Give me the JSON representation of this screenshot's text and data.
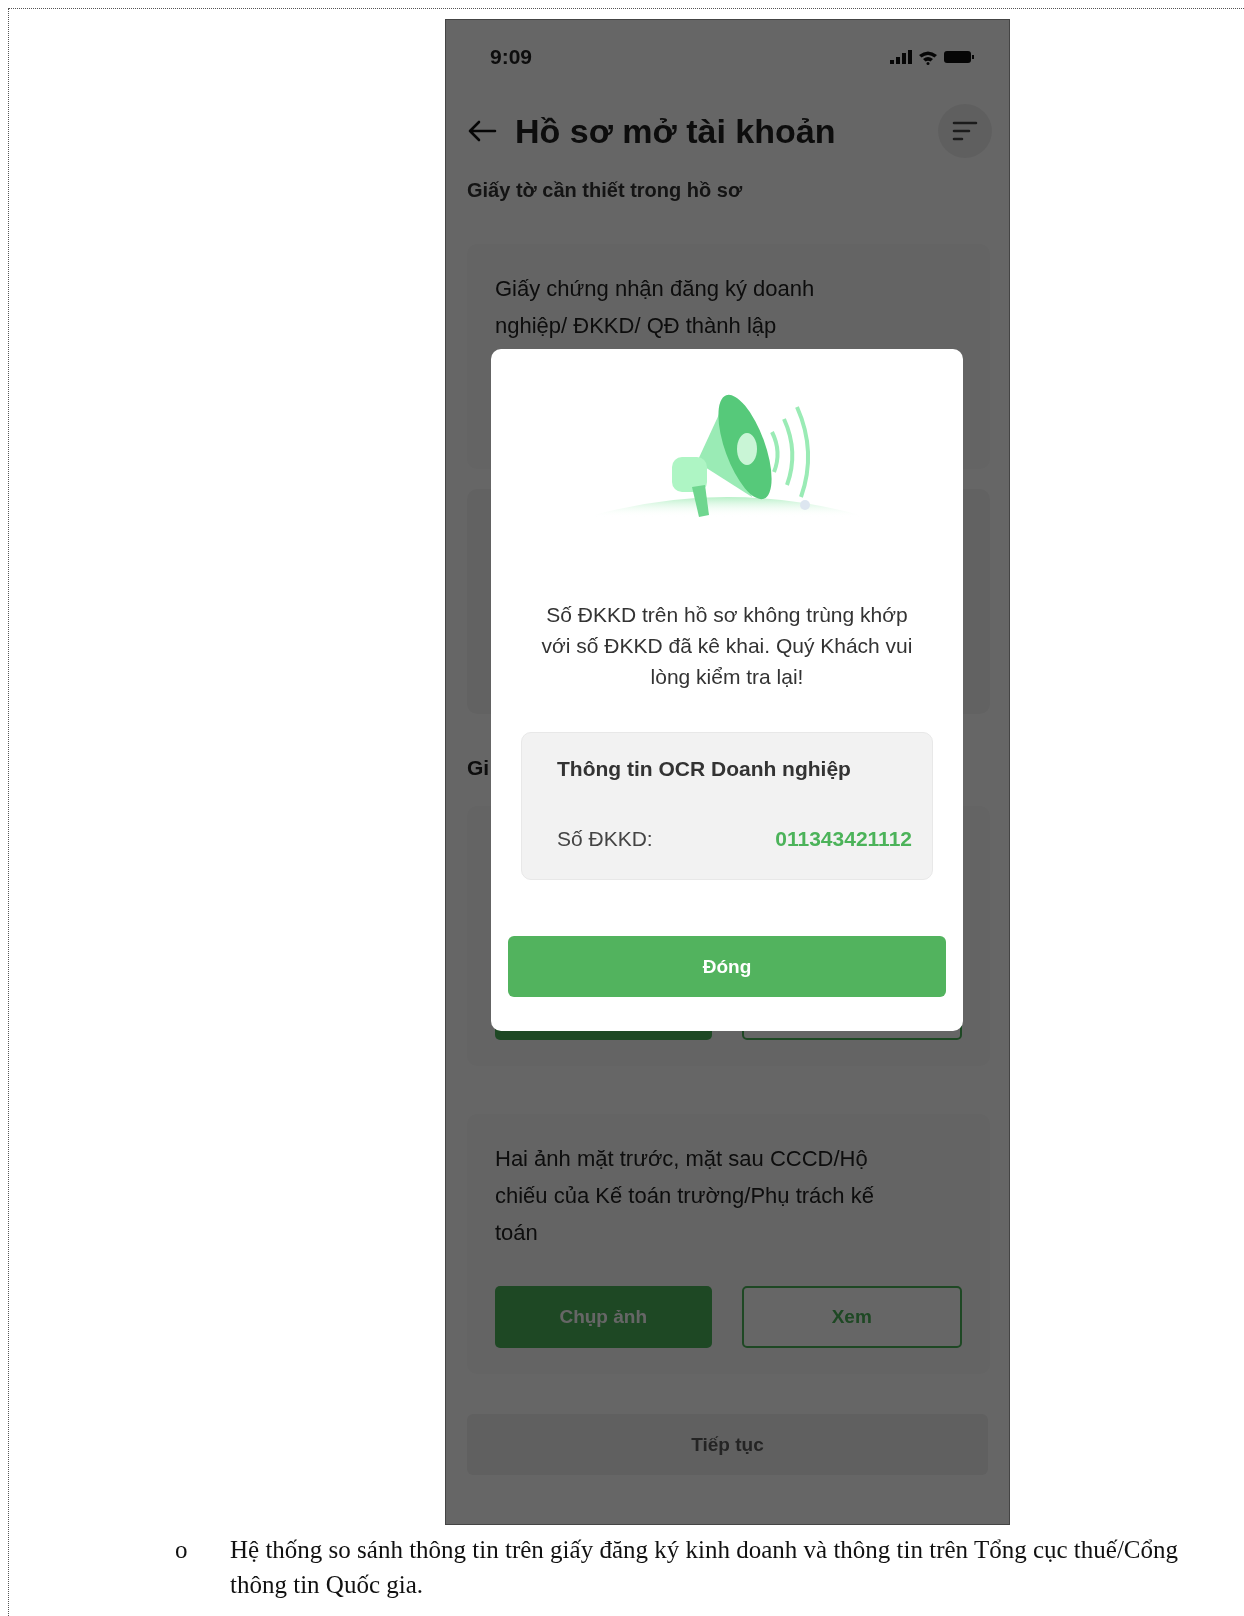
{
  "screenshot": {
    "status_bar": {
      "time": "9:09"
    },
    "header": {
      "title": "Hồ sơ mở tài khoản"
    },
    "section_title": "Giấy tờ cần thiết trong hồ sơ",
    "cards": [
      {
        "kind": "document",
        "text": "Giấy chứng nhận đăng ký doanh nghiệp/ ĐKKD/ QĐ thành lập"
      },
      {
        "kind": "covered"
      },
      {
        "kind": "document",
        "heading": "Gi",
        "buttons": [
          {
            "kind": "primary"
          },
          {
            "kind": "secondary"
          }
        ]
      },
      {
        "kind": "document",
        "text": "Hai ảnh mặt trước, mặt sau CCCD/Hộ chiếu của Kế toán trường/Phụ trách kế toán",
        "buttons": [
          {
            "kind": "primary",
            "label": "Chụp ảnh"
          },
          {
            "kind": "secondary",
            "label": "Xem"
          }
        ]
      }
    ],
    "continue_button": {
      "label": "Tiếp tục",
      "disabled": true
    },
    "dialog": {
      "message": "Số ĐKKD trên hồ sơ không trùng khớp với số ĐKKD đã kê khai. Quý Khách vui lòng kiểm tra lại!",
      "info_box": {
        "title": "Thông tin OCR Doanh nghiệp",
        "rows": [
          {
            "label": "Số ĐKKD:",
            "value": "011343421112"
          }
        ]
      },
      "button": "Đóng"
    }
  },
  "bullet": {
    "marker": "o",
    "text": "Hệ thống so sánh thông tin trên giấy đăng ký kinh doanh và thông tin trên Tổng cục thuế/Cổng thông tin Quốc gia."
  }
}
